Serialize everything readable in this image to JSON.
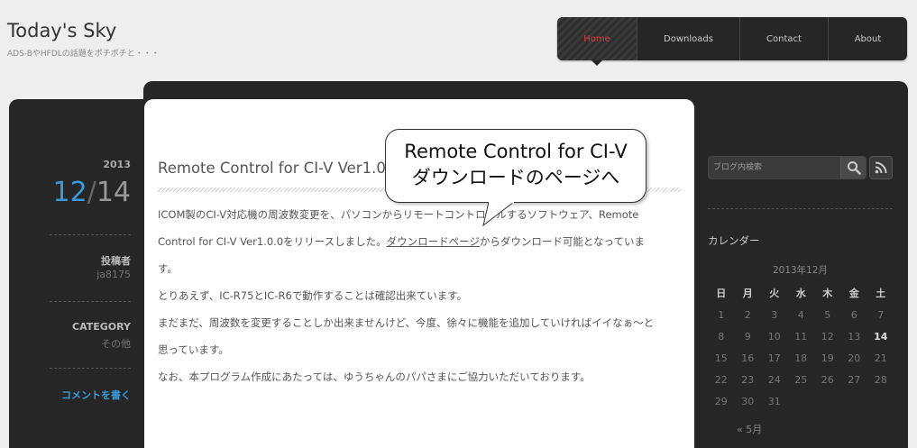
{
  "site": {
    "title": "Today's Sky",
    "description": "ADS-BやHFDLの話題をポチポチと・・・"
  },
  "nav": {
    "items": [
      {
        "label": "Home",
        "active": true
      },
      {
        "label": "Downloads"
      },
      {
        "label": "Contact"
      },
      {
        "label": "About"
      }
    ]
  },
  "post_meta": {
    "year": "2013",
    "month": "12",
    "separator": "/",
    "day": "14",
    "author_label": "投稿者",
    "author": "ja8175",
    "category_label": "CATEGORY",
    "category": "その他",
    "comment_link": "コメントを書く"
  },
  "post": {
    "title": "Remote Control for CI-V Ver1.0.0",
    "line1": "ICOM製のCI-V対応機の周波数変更を、パソコンからリモートコントロールするソフトウェア、Remote",
    "line2a": "Control for CI-V Ver1.0.0をリリースしました。",
    "line2_link": "ダウンロードページ",
    "line2b": "からダウンロード可能となっていま",
    "line3": "す。",
    "line4": "とりあえず、IC-R75とIC-R6で動作することは確認出来ています。",
    "line5": "まだまだ、周波数を変更することしか出来ませんけど、今度、徐々に機能を追加していければイイなぁ～と",
    "line6": "思っています。",
    "line7": "なお、本プログラム作成にあたっては、ゆうちゃんのパパさまにご協力いただいております。"
  },
  "callout": {
    "line1": "Remote Control for CI-V",
    "line2": "ダウンロードのページへ"
  },
  "sidebar": {
    "search_placeholder": "ブログ内検索",
    "search_icon": "magnifier-icon",
    "rss_icon": "rss-icon",
    "calendar_title": "カレンダー",
    "calendar_caption": "2013年12月",
    "weekdays": [
      "日",
      "月",
      "火",
      "水",
      "木",
      "金",
      "土"
    ],
    "weeks": [
      [
        "1",
        "2",
        "3",
        "4",
        "5",
        "6",
        "7"
      ],
      [
        "8",
        "9",
        "10",
        "11",
        "12",
        "13",
        "14"
      ],
      [
        "15",
        "16",
        "17",
        "18",
        "19",
        "20",
        "21"
      ],
      [
        "22",
        "23",
        "24",
        "25",
        "26",
        "27",
        "28"
      ],
      [
        "29",
        "30",
        "31",
        "",
        "",
        "",
        ""
      ]
    ],
    "today": "14",
    "prev_month": "« 5月"
  },
  "colors": {
    "accent_blue": "#3a9ad9",
    "nav_active": "#e83a3a",
    "dark_bg": "#262626"
  }
}
